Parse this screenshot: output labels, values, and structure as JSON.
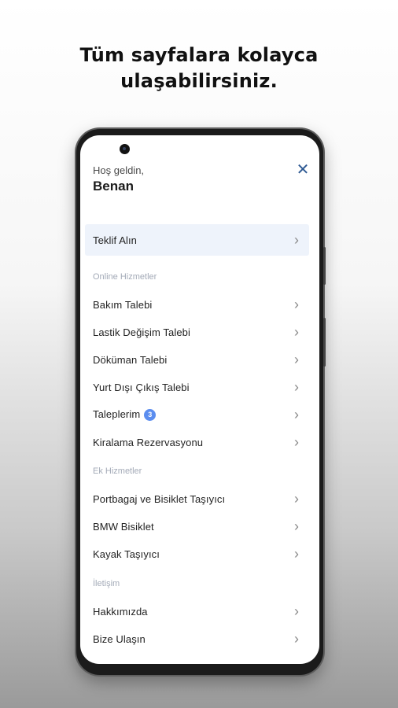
{
  "headline": {
    "line1": "Tüm sayfalara kolayca",
    "line2": "ulaşabilirsiniz."
  },
  "menu": {
    "greeting": "Hoş geldin,",
    "username": "Benan",
    "close_icon": "close-icon",
    "featured": {
      "label": "Teklif Alın"
    },
    "sections": {
      "online": {
        "title": "Online Hizmetler",
        "items": [
          {
            "label": "Bakım Talebi"
          },
          {
            "label": "Lastik Değişim Talebi"
          },
          {
            "label": "Döküman Talebi"
          },
          {
            "label": "Yurt Dışı Çıkış Talebi"
          },
          {
            "label": "Taleplerim",
            "badge": "3"
          },
          {
            "label": "Kiralama Rezervasyonu"
          }
        ]
      },
      "extra": {
        "title": "Ek Hizmetler",
        "items": [
          {
            "label": "Portbagaj ve Bisiklet Taşıyıcı"
          },
          {
            "label": "BMW Bisiklet"
          },
          {
            "label": "Kayak Taşıyıcı"
          }
        ]
      },
      "contact": {
        "title": "İletişim",
        "items": [
          {
            "label": "Hakkımızda"
          },
          {
            "label": "Bize Ulaşın"
          }
        ]
      }
    }
  },
  "colors": {
    "accent": "#2f5a93",
    "badge": "#5b8def",
    "highlight_row": "#eef3fb",
    "section_label": "#a3aab7"
  }
}
